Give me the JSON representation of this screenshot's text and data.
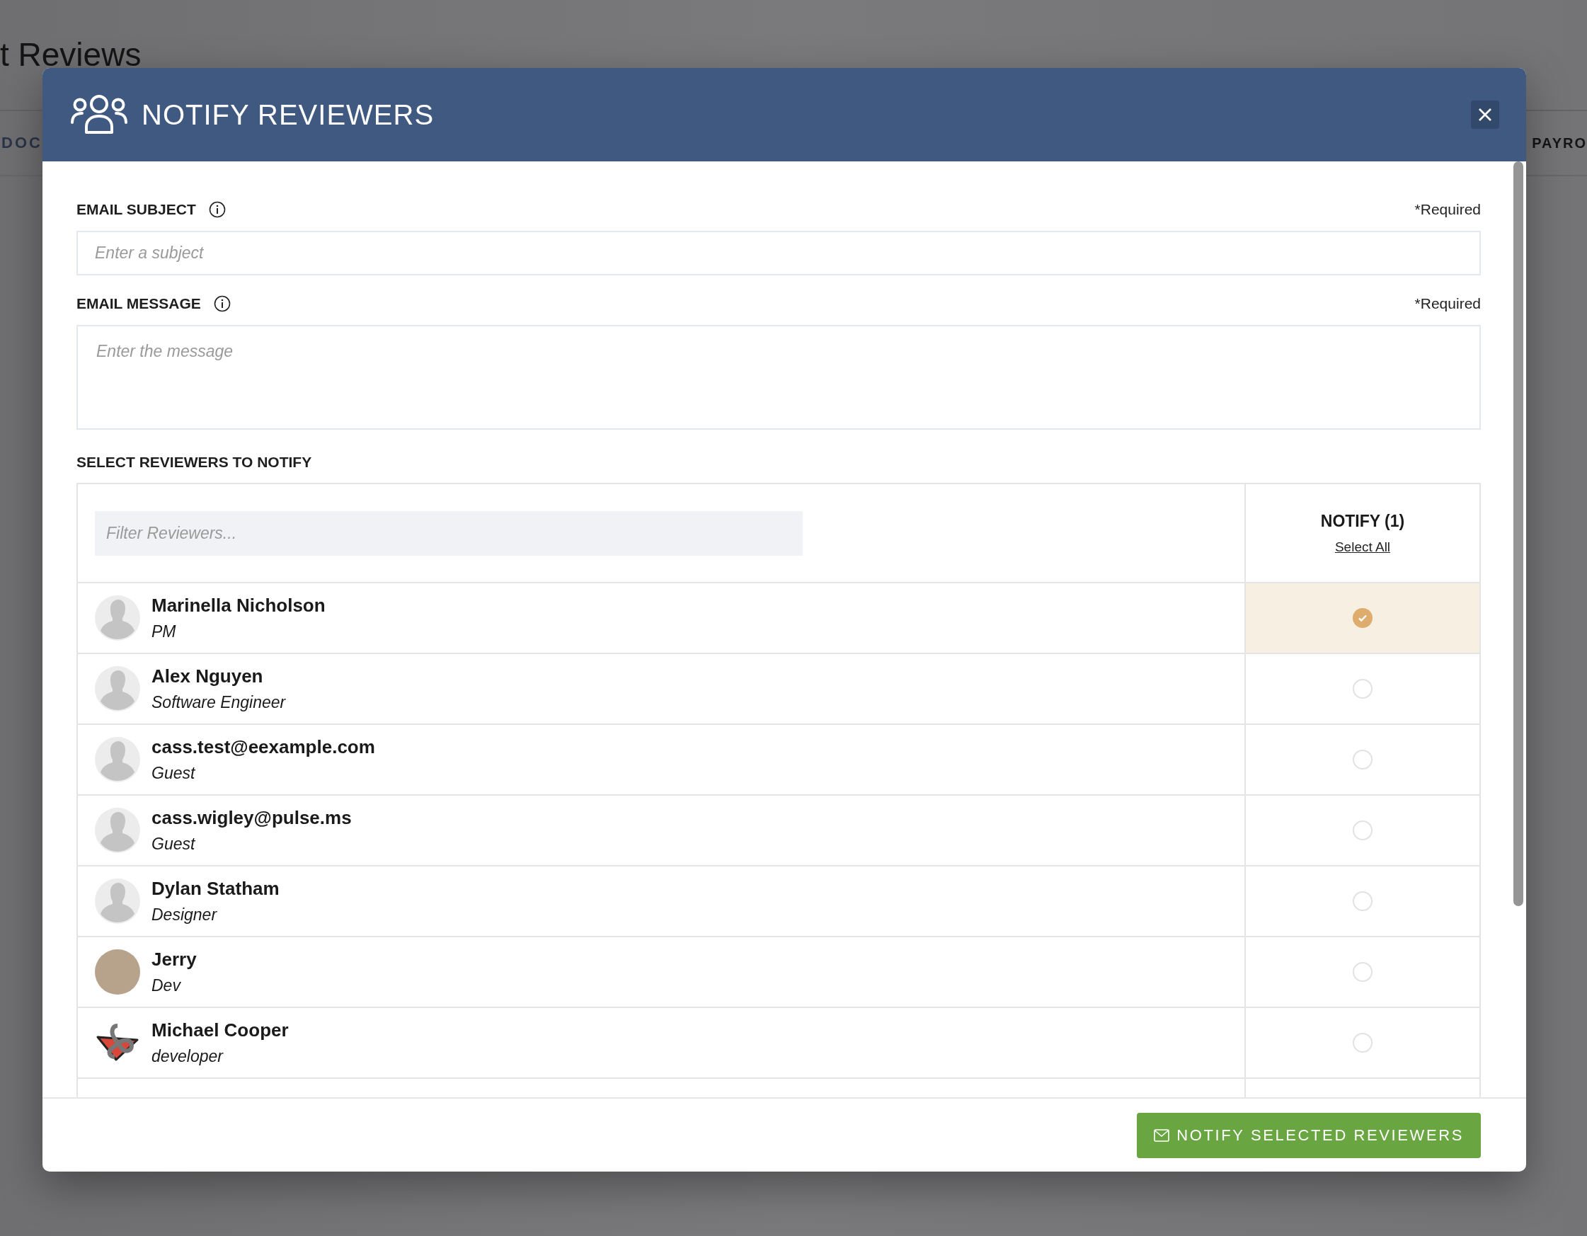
{
  "background": {
    "page_title": "t Reviews",
    "tabs": [
      "DOC",
      "PAYRO"
    ]
  },
  "dialog": {
    "title": "NOTIFY REVIEWERS"
  },
  "subject": {
    "label": "EMAIL SUBJECT",
    "required": "*Required",
    "placeholder": "Enter a subject"
  },
  "message": {
    "label": "EMAIL MESSAGE",
    "required": "*Required",
    "placeholder": "Enter the message"
  },
  "reviewers": {
    "heading": "SELECT REVIEWERS TO NOTIFY",
    "filter_placeholder": "Filter Reviewers...",
    "notify_header": "NOTIFY (1)",
    "select_all": "Select All",
    "rows": [
      {
        "name": "Marinella Nicholson",
        "role": "PM",
        "kind": "silhouette",
        "selected": true
      },
      {
        "name": "Alex Nguyen",
        "role": "Software Engineer",
        "kind": "silhouette",
        "selected": false
      },
      {
        "name": "cass.test@eexample.com",
        "role": "Guest",
        "kind": "silhouette",
        "selected": false
      },
      {
        "name": "cass.wigley@pulse.ms",
        "role": "Guest",
        "kind": "silhouette",
        "selected": false
      },
      {
        "name": "Dylan Statham",
        "role": "Designer",
        "kind": "silhouette",
        "selected": false
      },
      {
        "name": "Jerry",
        "role": "Dev",
        "kind": "photo",
        "selected": false
      },
      {
        "name": "Michael Cooper",
        "role": "developer",
        "kind": "logo",
        "selected": false
      }
    ]
  },
  "footer_button": "NOTIFY SELECTED REVIEWERS"
}
